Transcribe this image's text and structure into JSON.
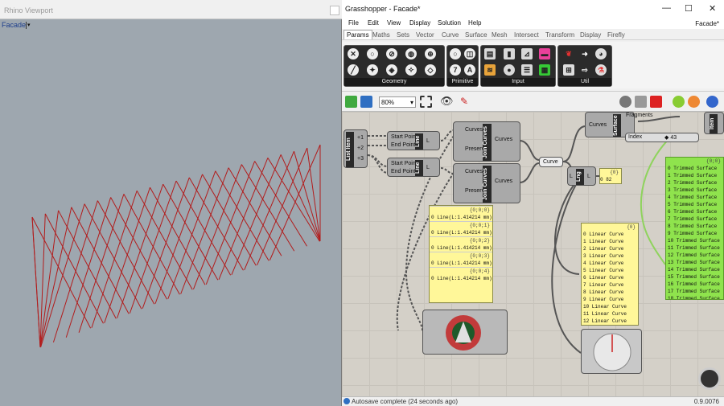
{
  "rhino": {
    "title": "Rhino Viewport",
    "viewport_label": "Facade"
  },
  "gh": {
    "window_title": "Grasshopper - Facade*",
    "menu": [
      "File",
      "Edit",
      "View",
      "Display",
      "Solution",
      "Help"
    ],
    "doc_name": "Facade*",
    "tabs": [
      "Params",
      "Maths",
      "Sets",
      "Vector",
      "Curve",
      "Surface",
      "Mesh",
      "Intersect",
      "Transform",
      "Display",
      "Firefly"
    ],
    "groups": [
      "Geometry",
      "Primitive",
      "Input",
      "Util"
    ],
    "zoom": "80%",
    "status": "Autosave complete (24 seconds ago)",
    "version": "0.9.0076"
  },
  "components": {
    "list_item": {
      "caption": "List Item",
      "inputs": [
        "+1",
        "+2",
        "+3"
      ]
    },
    "line1": {
      "caption": "Line",
      "inputs": [
        "Start Point",
        "End Point"
      ]
    },
    "line2": {
      "caption": "Line",
      "inputs": [
        "Start Point",
        "End Point"
      ]
    },
    "join1": {
      "caption": "Join Curves",
      "inputs": [
        "Curves",
        "Preserve"
      ],
      "output": "Curves"
    },
    "join2": {
      "caption": "Join Curves",
      "inputs": [
        "Curves",
        "Preserve"
      ],
      "output": "Curves"
    },
    "curve_param": {
      "label": "Curve"
    },
    "length": {
      "caption": "Lng",
      "inputs": [
        "L"
      ]
    },
    "surface": {
      "caption": "Surface",
      "inputs": [
        "Curves"
      ]
    },
    "fragments": {
      "label": "Fragments",
      "index_label": "Index",
      "index_value": "◆ 43"
    },
    "item_right": {
      "caption": "Item"
    }
  },
  "panels": {
    "length_value": {
      "header": "{0}",
      "rows": [
        "0 82"
      ]
    },
    "lines": {
      "header_rows": [
        "{0;0;0}",
        "{0;0;1}",
        "{0;0;2}",
        "{0;0;3}",
        "{0;0;4}"
      ],
      "row_text": "Line(L:1.414214 mm)"
    },
    "linear": {
      "header": "{0}",
      "rows": [
        "0 Linear Curve",
        "1 Linear Curve",
        "2 Linear Curve",
        "3 Linear Curve",
        "4 Linear Curve",
        "5 Linear Curve",
        "6 Linear Curve",
        "7 Linear Curve",
        "8 Linear Curve",
        "9 Linear Curve",
        "10 Linear Curve",
        "11 Linear Curve",
        "12 Linear Curve"
      ]
    },
    "trimmed": {
      "header": "{0;0}",
      "rows": [
        "0 Trimmed Surface",
        "1 Trimmed Surface",
        "2 Trimmed Surface",
        "3 Trimmed Surface",
        "4 Trimmed Surface",
        "5 Trimmed Surface",
        "6 Trimmed Surface",
        "7 Trimmed Surface",
        "8 Trimmed Surface",
        "9 Trimmed Surface",
        "10 Trimmed Surface",
        "11 Trimmed Surface",
        "12 Trimmed Surface",
        "13 Trimmed Surface",
        "14 Trimmed Surface",
        "15 Trimmed Surface",
        "16 Trimmed Surface",
        "17 Trimmed Surface",
        "18 Trimmed Surface",
        "19 Trimmed Surface",
        "20 Trimmed Surface",
        "21 Trimmed Surface",
        "22 Trimmed Surface",
        "23 Trimmed Surface"
      ]
    }
  },
  "colors": {
    "viewport_bg": "#9ea7af",
    "mesh": "#b21c1c",
    "panel": "#fff799",
    "panel_green": "#8fe34d"
  }
}
